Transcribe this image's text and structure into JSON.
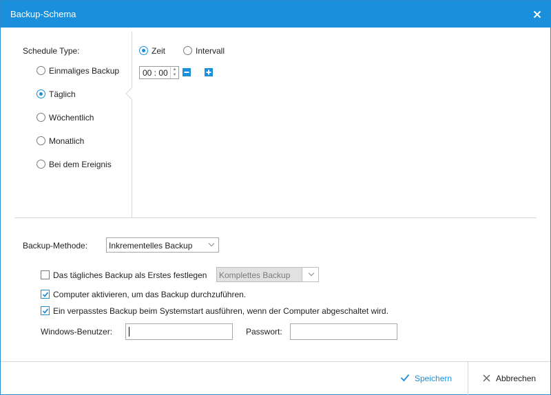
{
  "window": {
    "title": "Backup-Schema"
  },
  "schedule": {
    "label": "Schedule Type:",
    "options": [
      {
        "label": "Einmaliges Backup",
        "selected": false
      },
      {
        "label": "Täglich",
        "selected": true
      },
      {
        "label": "Wöchentlich",
        "selected": false
      },
      {
        "label": "Monatlich",
        "selected": false
      },
      {
        "label": "Bei dem Ereignis",
        "selected": false
      }
    ]
  },
  "mode": {
    "options": [
      {
        "label": "Zeit",
        "selected": true
      },
      {
        "label": "Intervall",
        "selected": false
      }
    ],
    "time_value": "00 : 00"
  },
  "method": {
    "label": "Backup-Methode:",
    "value": "Inkrementelles Backup"
  },
  "options": {
    "first_backup": {
      "label": "Das tägliches Backup als Erstes festlegen",
      "checked": false,
      "select_value": "Komplettes Backup"
    },
    "wake_computer": {
      "label": "Computer aktivieren, um das Backup durchzuführen.",
      "checked": true
    },
    "missed_backup": {
      "label": "Ein verpasstes Backup beim Systemstart ausführen, wenn der Computer abgeschaltet wird.",
      "checked": true
    }
  },
  "credentials": {
    "user_label": "Windows-Benutzer:",
    "user_value": "",
    "password_label": "Passwort:",
    "password_value": ""
  },
  "footer": {
    "save_label": "Speichern",
    "cancel_label": "Abbrechen"
  },
  "colors": {
    "accent": "#1a8fdb",
    "title_text": "#ffffff"
  }
}
